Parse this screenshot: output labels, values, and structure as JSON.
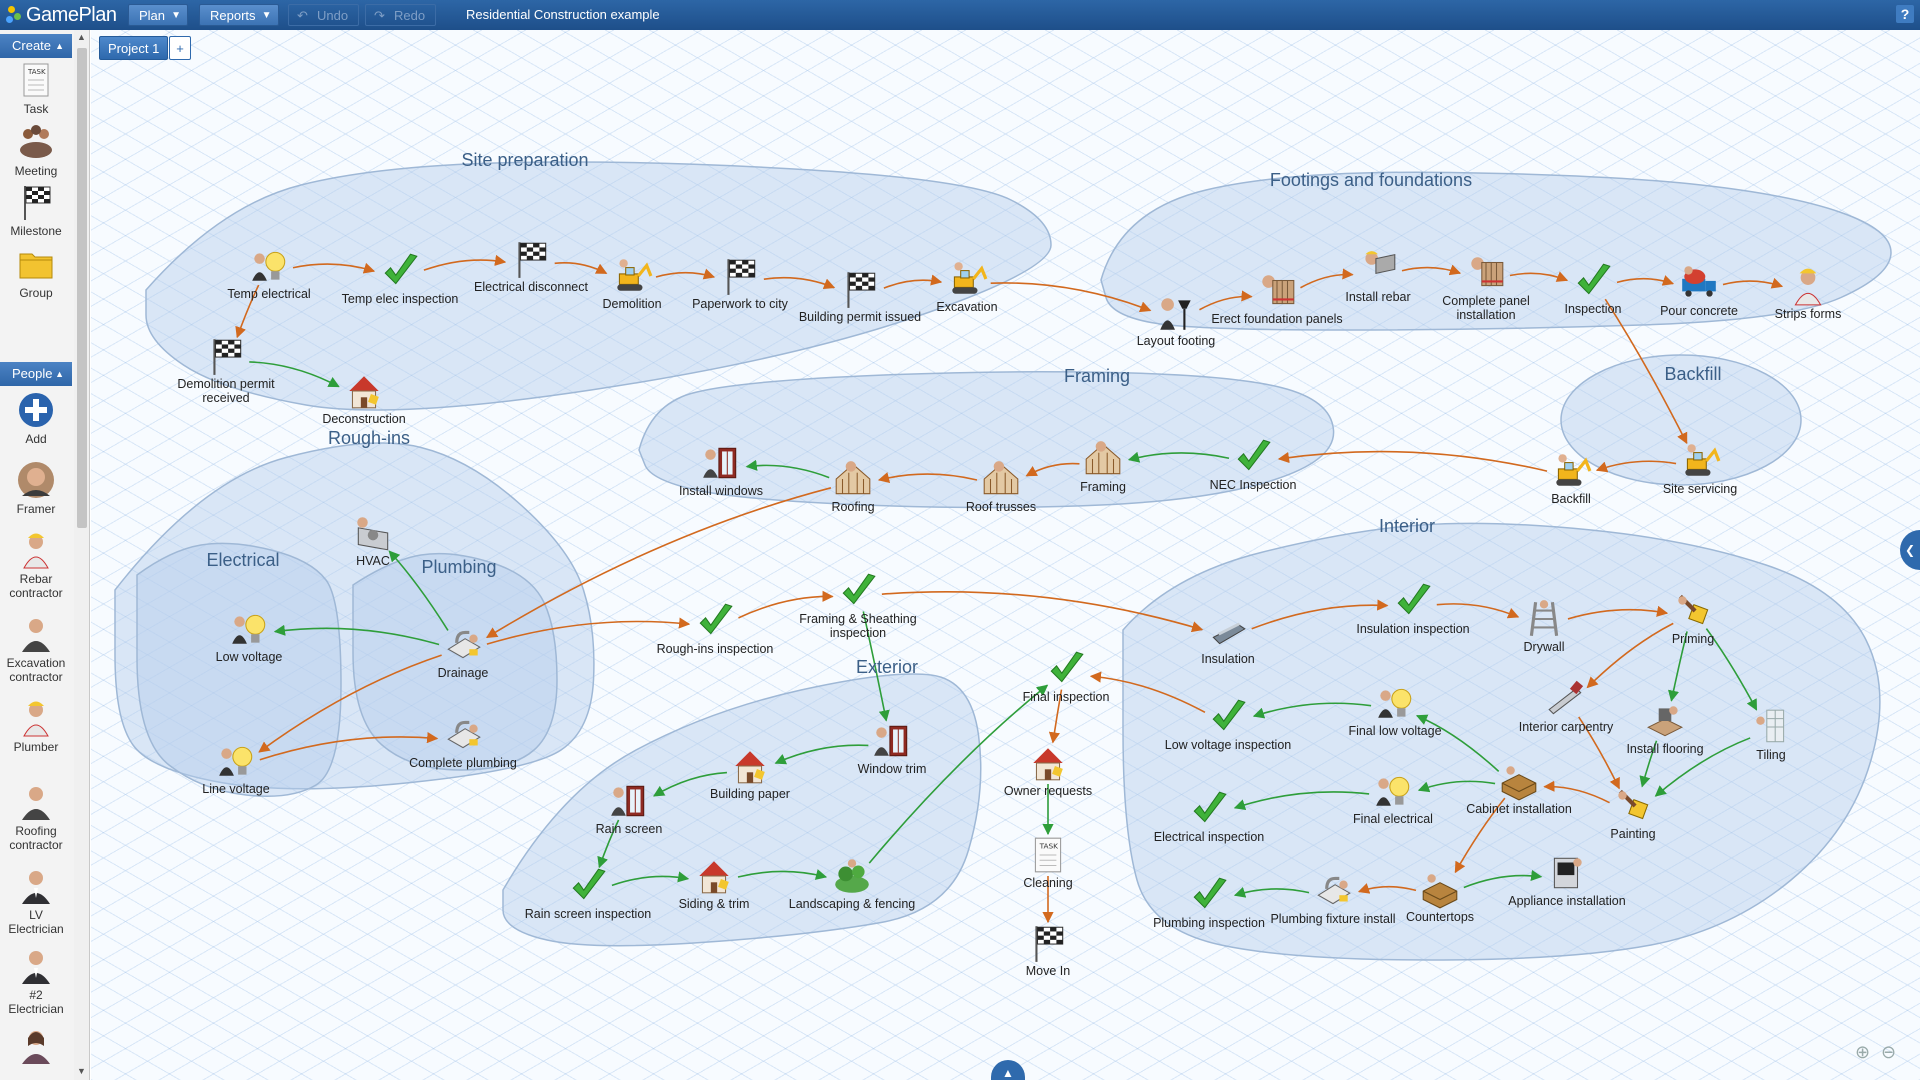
{
  "app": {
    "name": "GamePlan",
    "document_title": "Residential Construction example",
    "help_label": "?"
  },
  "toolbar": {
    "plan_label": "Plan",
    "reports_label": "Reports",
    "undo_label": "Undo",
    "redo_label": "Redo"
  },
  "tabs": {
    "project_label": "Project 1",
    "add_label": "+"
  },
  "sidebar": {
    "create_header": "Create",
    "create_items": [
      {
        "label": "Task",
        "icon": "task-icon"
      },
      {
        "label": "Meeting",
        "icon": "meeting-icon"
      },
      {
        "label": "Milestone",
        "icon": "milestone-flag-icon"
      },
      {
        "label": "Group",
        "icon": "folder-icon"
      }
    ],
    "people_header": "People",
    "people_items": [
      {
        "label": "Add",
        "icon": "add-person-icon"
      },
      {
        "label": "Framer",
        "icon": "person-photo-icon"
      },
      {
        "label": "Rebar contractor",
        "icon": "worker-icon"
      },
      {
        "label": "Excavation contractor",
        "icon": "person-icon"
      },
      {
        "label": "Plumber",
        "icon": "worker-icon"
      },
      {
        "label": "Roofing contractor",
        "icon": "person-icon"
      },
      {
        "label": "LV Electrician",
        "icon": "person-suit-icon"
      },
      {
        "label": "#2 Electrician",
        "icon": "person-suit-icon"
      },
      {
        "label": "",
        "icon": "person-female-icon"
      }
    ]
  },
  "groups": [
    {
      "id": "site",
      "label": "Site preparation"
    },
    {
      "id": "foot",
      "label": "Footings and foundations"
    },
    {
      "id": "framing",
      "label": "Framing"
    },
    {
      "id": "backfill",
      "label": "Backfill"
    },
    {
      "id": "rough",
      "label": "Rough-ins"
    },
    {
      "id": "electrical",
      "label": "Electrical"
    },
    {
      "id": "plumbing",
      "label": "Plumbing"
    },
    {
      "id": "interior",
      "label": "Interior"
    },
    {
      "id": "exterior",
      "label": "Exterior"
    }
  ],
  "nodes": [
    {
      "id": "temp_elec",
      "label": "Temp electrical",
      "icon": "electrician-bulb-icon"
    },
    {
      "id": "temp_elec_insp",
      "label": "Temp elec inspection",
      "icon": "checkmark-icon"
    },
    {
      "id": "elec_disconnect",
      "label": "Electrical disconnect",
      "icon": "milestone-flag-icon"
    },
    {
      "id": "demolition",
      "label": "Demolition",
      "icon": "excavator-icon"
    },
    {
      "id": "paperwork",
      "label": "Paperwork to city",
      "icon": "milestone-flag-icon"
    },
    {
      "id": "building_permit",
      "label": "Building permit issued",
      "icon": "milestone-flag-icon"
    },
    {
      "id": "excavation",
      "label": "Excavation",
      "icon": "excavator-icon"
    },
    {
      "id": "demo_permit",
      "label": "Demolition permit received",
      "icon": "milestone-flag-icon"
    },
    {
      "id": "deconstruction",
      "label": "Deconstruction",
      "icon": "house-icon"
    },
    {
      "id": "layout_footing",
      "label": "Layout footing",
      "icon": "layout-worker-icon"
    },
    {
      "id": "erect_panels",
      "label": "Erect foundation panels",
      "icon": "panel-worker-icon"
    },
    {
      "id": "install_rebar",
      "label": "Install rebar",
      "icon": "rebar-worker-icon"
    },
    {
      "id": "complete_panel",
      "label": "Complete panel installation",
      "icon": "panel-worker-icon"
    },
    {
      "id": "inspection",
      "label": "Inspection",
      "icon": "checkmark-icon"
    },
    {
      "id": "pour_concrete",
      "label": "Pour concrete",
      "icon": "concrete-truck-icon"
    },
    {
      "id": "strips_forms",
      "label": "Strips forms",
      "icon": "worker-icon"
    },
    {
      "id": "install_windows",
      "label": "Install windows",
      "icon": "window-worker-icon"
    },
    {
      "id": "roofing",
      "label": "Roofing",
      "icon": "framing-icon"
    },
    {
      "id": "roof_trusses",
      "label": "Roof trusses",
      "icon": "framing-icon"
    },
    {
      "id": "framing",
      "label": "Framing",
      "icon": "framing-icon"
    },
    {
      "id": "nec_insp",
      "label": "NEC Inspection",
      "icon": "checkmark-icon"
    },
    {
      "id": "backfill",
      "label": "Backfill",
      "icon": "excavator-icon"
    },
    {
      "id": "site_servicing",
      "label": "Site servicing",
      "icon": "excavator-icon"
    },
    {
      "id": "hvac",
      "label": "HVAC",
      "icon": "hvac-icon"
    },
    {
      "id": "low_voltage",
      "label": "Low voltage",
      "icon": "electrician-bulb-icon"
    },
    {
      "id": "drainage",
      "label": "Drainage",
      "icon": "plumbing-icon"
    },
    {
      "id": "line_voltage",
      "label": "Line voltage",
      "icon": "electrician-bulb-icon"
    },
    {
      "id": "complete_plumbing",
      "label": "Complete plumbing",
      "icon": "plumbing-icon"
    },
    {
      "id": "roughins_insp",
      "label": "Rough-ins inspection",
      "icon": "checkmark-icon"
    },
    {
      "id": "framing_sheathing",
      "label": "Framing & Sheathing inspection",
      "icon": "checkmark-icon"
    },
    {
      "id": "window_trim",
      "label": "Window trim",
      "icon": "window-worker-icon"
    },
    {
      "id": "building_paper",
      "label": "Building paper",
      "icon": "house-icon"
    },
    {
      "id": "rain_screen",
      "label": "Rain screen",
      "icon": "window-worker-icon"
    },
    {
      "id": "rain_screen_insp",
      "label": "Rain screen inspection",
      "icon": "checkmark-icon"
    },
    {
      "id": "siding_trim",
      "label": "Siding & trim",
      "icon": "house-icon"
    },
    {
      "id": "landscaping",
      "label": "Landscaping & fencing",
      "icon": "landscaping-icon"
    },
    {
      "id": "final_insp",
      "label": "Final inspection",
      "icon": "checkmark-icon"
    },
    {
      "id": "owner_requests",
      "label": "Owner requests",
      "icon": "house-icon"
    },
    {
      "id": "cleaning",
      "label": "Cleaning",
      "icon": "task-icon"
    },
    {
      "id": "move_in",
      "label": "Move In",
      "icon": "milestone-flag-icon"
    },
    {
      "id": "insulation",
      "label": "Insulation",
      "icon": "stapler-icon"
    },
    {
      "id": "insulation_insp",
      "label": "Insulation inspection",
      "icon": "checkmark-icon"
    },
    {
      "id": "drywall",
      "label": "Drywall",
      "icon": "ladder-icon"
    },
    {
      "id": "priming",
      "label": "Priming",
      "icon": "paint-icon"
    },
    {
      "id": "low_voltage_insp",
      "label": "Low voltage inspection",
      "icon": "checkmark-icon"
    },
    {
      "id": "final_low_voltage",
      "label": "Final low voltage",
      "icon": "electrician-bulb-icon"
    },
    {
      "id": "interior_carpentry",
      "label": "Interior carpentry",
      "icon": "saw-icon"
    },
    {
      "id": "install_flooring",
      "label": "Install flooring",
      "icon": "flooring-icon"
    },
    {
      "id": "tiling",
      "label": "Tiling",
      "icon": "tiling-icon"
    },
    {
      "id": "final_electrical",
      "label": "Final electrical",
      "icon": "electrician-bulb-icon"
    },
    {
      "id": "cabinet_install",
      "label": "Cabinet installation",
      "icon": "cabinet-icon"
    },
    {
      "id": "painting",
      "label": "Painting",
      "icon": "paint-icon"
    },
    {
      "id": "electrical_insp",
      "label": "Electrical inspection",
      "icon": "checkmark-icon"
    },
    {
      "id": "plumbing_insp",
      "label": "Plumbing inspection",
      "icon": "checkmark-icon"
    },
    {
      "id": "plumbing_fixture",
      "label": "Plumbing fixture install",
      "icon": "plumbing-icon"
    },
    {
      "id": "countertops",
      "label": "Countertops",
      "icon": "cabinet-icon"
    },
    {
      "id": "appliance_install",
      "label": "Appliance installation",
      "icon": "appliance-icon"
    }
  ],
  "links": [
    [
      "temp_elec",
      "temp_elec_insp",
      "o"
    ],
    [
      "temp_elec_insp",
      "elec_disconnect",
      "o"
    ],
    [
      "elec_disconnect",
      "demolition",
      "o"
    ],
    [
      "demolition",
      "paperwork",
      "o"
    ],
    [
      "paperwork",
      "building_permit",
      "o"
    ],
    [
      "building_permit",
      "excavation",
      "o"
    ],
    [
      "temp_elec",
      "demo_permit",
      "o"
    ],
    [
      "demo_permit",
      "deconstruction",
      "g"
    ],
    [
      "excavation",
      "layout_footing",
      "o"
    ],
    [
      "layout_footing",
      "erect_panels",
      "o"
    ],
    [
      "erect_panels",
      "install_rebar",
      "o"
    ],
    [
      "install_rebar",
      "complete_panel",
      "o"
    ],
    [
      "complete_panel",
      "inspection",
      "o"
    ],
    [
      "inspection",
      "pour_concrete",
      "o"
    ],
    [
      "pour_concrete",
      "strips_forms",
      "o"
    ],
    [
      "inspection",
      "site_servicing",
      "o"
    ],
    [
      "site_servicing",
      "backfill",
      "o"
    ],
    [
      "backfill",
      "nec_insp",
      "o"
    ],
    [
      "nec_insp",
      "framing",
      "g"
    ],
    [
      "framing",
      "roof_trusses",
      "o"
    ],
    [
      "roof_trusses",
      "roofing",
      "o"
    ],
    [
      "roofing",
      "install_windows",
      "g"
    ],
    [
      "roofing",
      "drainage",
      "o"
    ],
    [
      "drainage",
      "hvac",
      "g"
    ],
    [
      "drainage",
      "low_voltage",
      "g"
    ],
    [
      "drainage",
      "line_voltage",
      "o"
    ],
    [
      "line_voltage",
      "complete_plumbing",
      "o"
    ],
    [
      "drainage",
      "roughins_insp",
      "o"
    ],
    [
      "roughins_insp",
      "framing_sheathing",
      "o"
    ],
    [
      "framing_sheathing",
      "insulation",
      "o"
    ],
    [
      "framing_sheathing",
      "window_trim",
      "g"
    ],
    [
      "window_trim",
      "building_paper",
      "g"
    ],
    [
      "building_paper",
      "rain_screen",
      "g"
    ],
    [
      "rain_screen",
      "rain_screen_insp",
      "g"
    ],
    [
      "rain_screen_insp",
      "siding_trim",
      "g"
    ],
    [
      "siding_trim",
      "landscaping",
      "g"
    ],
    [
      "landscaping",
      "final_insp",
      "g"
    ],
    [
      "final_insp",
      "owner_requests",
      "o"
    ],
    [
      "owner_requests",
      "cleaning",
      "g"
    ],
    [
      "cleaning",
      "move_in",
      "o"
    ],
    [
      "insulation",
      "insulation_insp",
      "o"
    ],
    [
      "insulation_insp",
      "drywall",
      "o"
    ],
    [
      "drywall",
      "priming",
      "o"
    ],
    [
      "priming",
      "interior_carpentry",
      "o"
    ],
    [
      "priming",
      "install_flooring",
      "g"
    ],
    [
      "priming",
      "tiling",
      "g"
    ],
    [
      "install_flooring",
      "painting",
      "g"
    ],
    [
      "tiling",
      "painting",
      "g"
    ],
    [
      "interior_carpentry",
      "painting",
      "o"
    ],
    [
      "painting",
      "cabinet_install",
      "o"
    ],
    [
      "cabinet_install",
      "final_low_voltage",
      "g"
    ],
    [
      "cabinet_install",
      "final_electrical",
      "g"
    ],
    [
      "final_low_voltage",
      "low_voltage_insp",
      "g"
    ],
    [
      "final_electrical",
      "electrical_insp",
      "g"
    ],
    [
      "cabinet_install",
      "countertops",
      "o"
    ],
    [
      "countertops",
      "appliance_install",
      "g"
    ],
    [
      "countertops",
      "plumbing_fixture",
      "o"
    ],
    [
      "plumbing_fixture",
      "plumbing_insp",
      "g"
    ],
    [
      "low_voltage_insp",
      "final_insp",
      "o"
    ]
  ],
  "colors": {
    "link_orange": "#d2691e",
    "link_green": "#2e9e3a",
    "brand_blue": "#2a5fa0"
  }
}
